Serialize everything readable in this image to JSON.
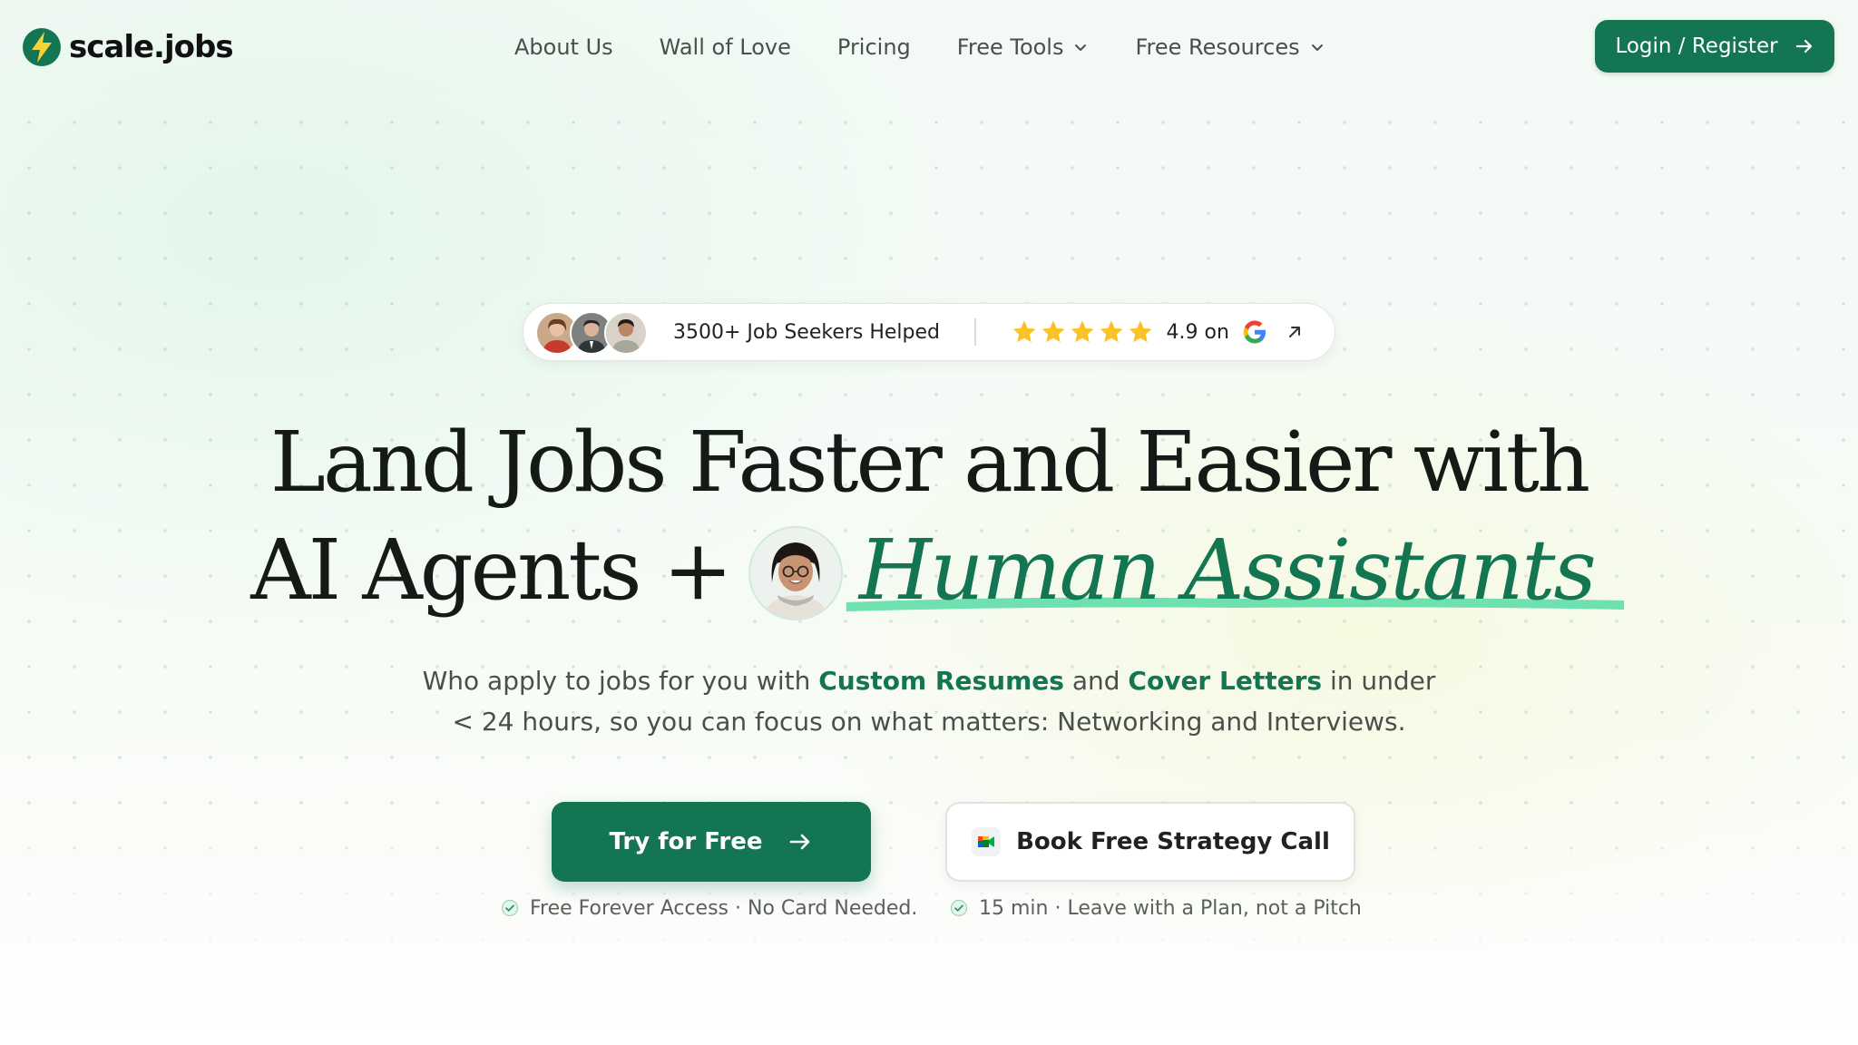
{
  "header": {
    "logo_text": "scale.jobs",
    "nav": [
      {
        "label": "About Us",
        "has_dropdown": false
      },
      {
        "label": "Wall of Love",
        "has_dropdown": false
      },
      {
        "label": "Pricing",
        "has_dropdown": false
      },
      {
        "label": "Free Tools",
        "has_dropdown": true
      },
      {
        "label": "Free Resources",
        "has_dropdown": true
      }
    ],
    "login_label": "Login / Register"
  },
  "social_proof": {
    "helped_text": "3500+ Job Seekers Helped",
    "stars": 5,
    "rating_text": "4.9 on",
    "icons": [
      "avatar-1",
      "avatar-2",
      "avatar-3",
      "star-icon",
      "google-icon",
      "arrow-up-right-icon"
    ]
  },
  "hero": {
    "headline_line1": "Land Jobs Faster and Easier with",
    "headline_line2_start": "AI Agents +",
    "headline_highlight": "Human Assistants",
    "subtitle_part1": "Who apply to jobs for you with ",
    "subtitle_hl1": "Custom Resumes",
    "subtitle_part2": " and ",
    "subtitle_hl2": "Cover Letters",
    "subtitle_part3": " in under",
    "subtitle_line2": "< 24 hours, so you can focus on what matters: Networking and Interviews."
  },
  "cta": {
    "primary_label": "Try for Free",
    "secondary_label": "Book Free Strategy Call",
    "note_primary": "Free Forever Access · No Card Needed.",
    "note_secondary": "15 min · Leave with a Plan, not a Pitch"
  },
  "colors": {
    "brand_green": "#137552",
    "highlight_mint": "#6fe0b0",
    "star_yellow": "#f7c325",
    "logo_yellow": "#f3d23a"
  }
}
